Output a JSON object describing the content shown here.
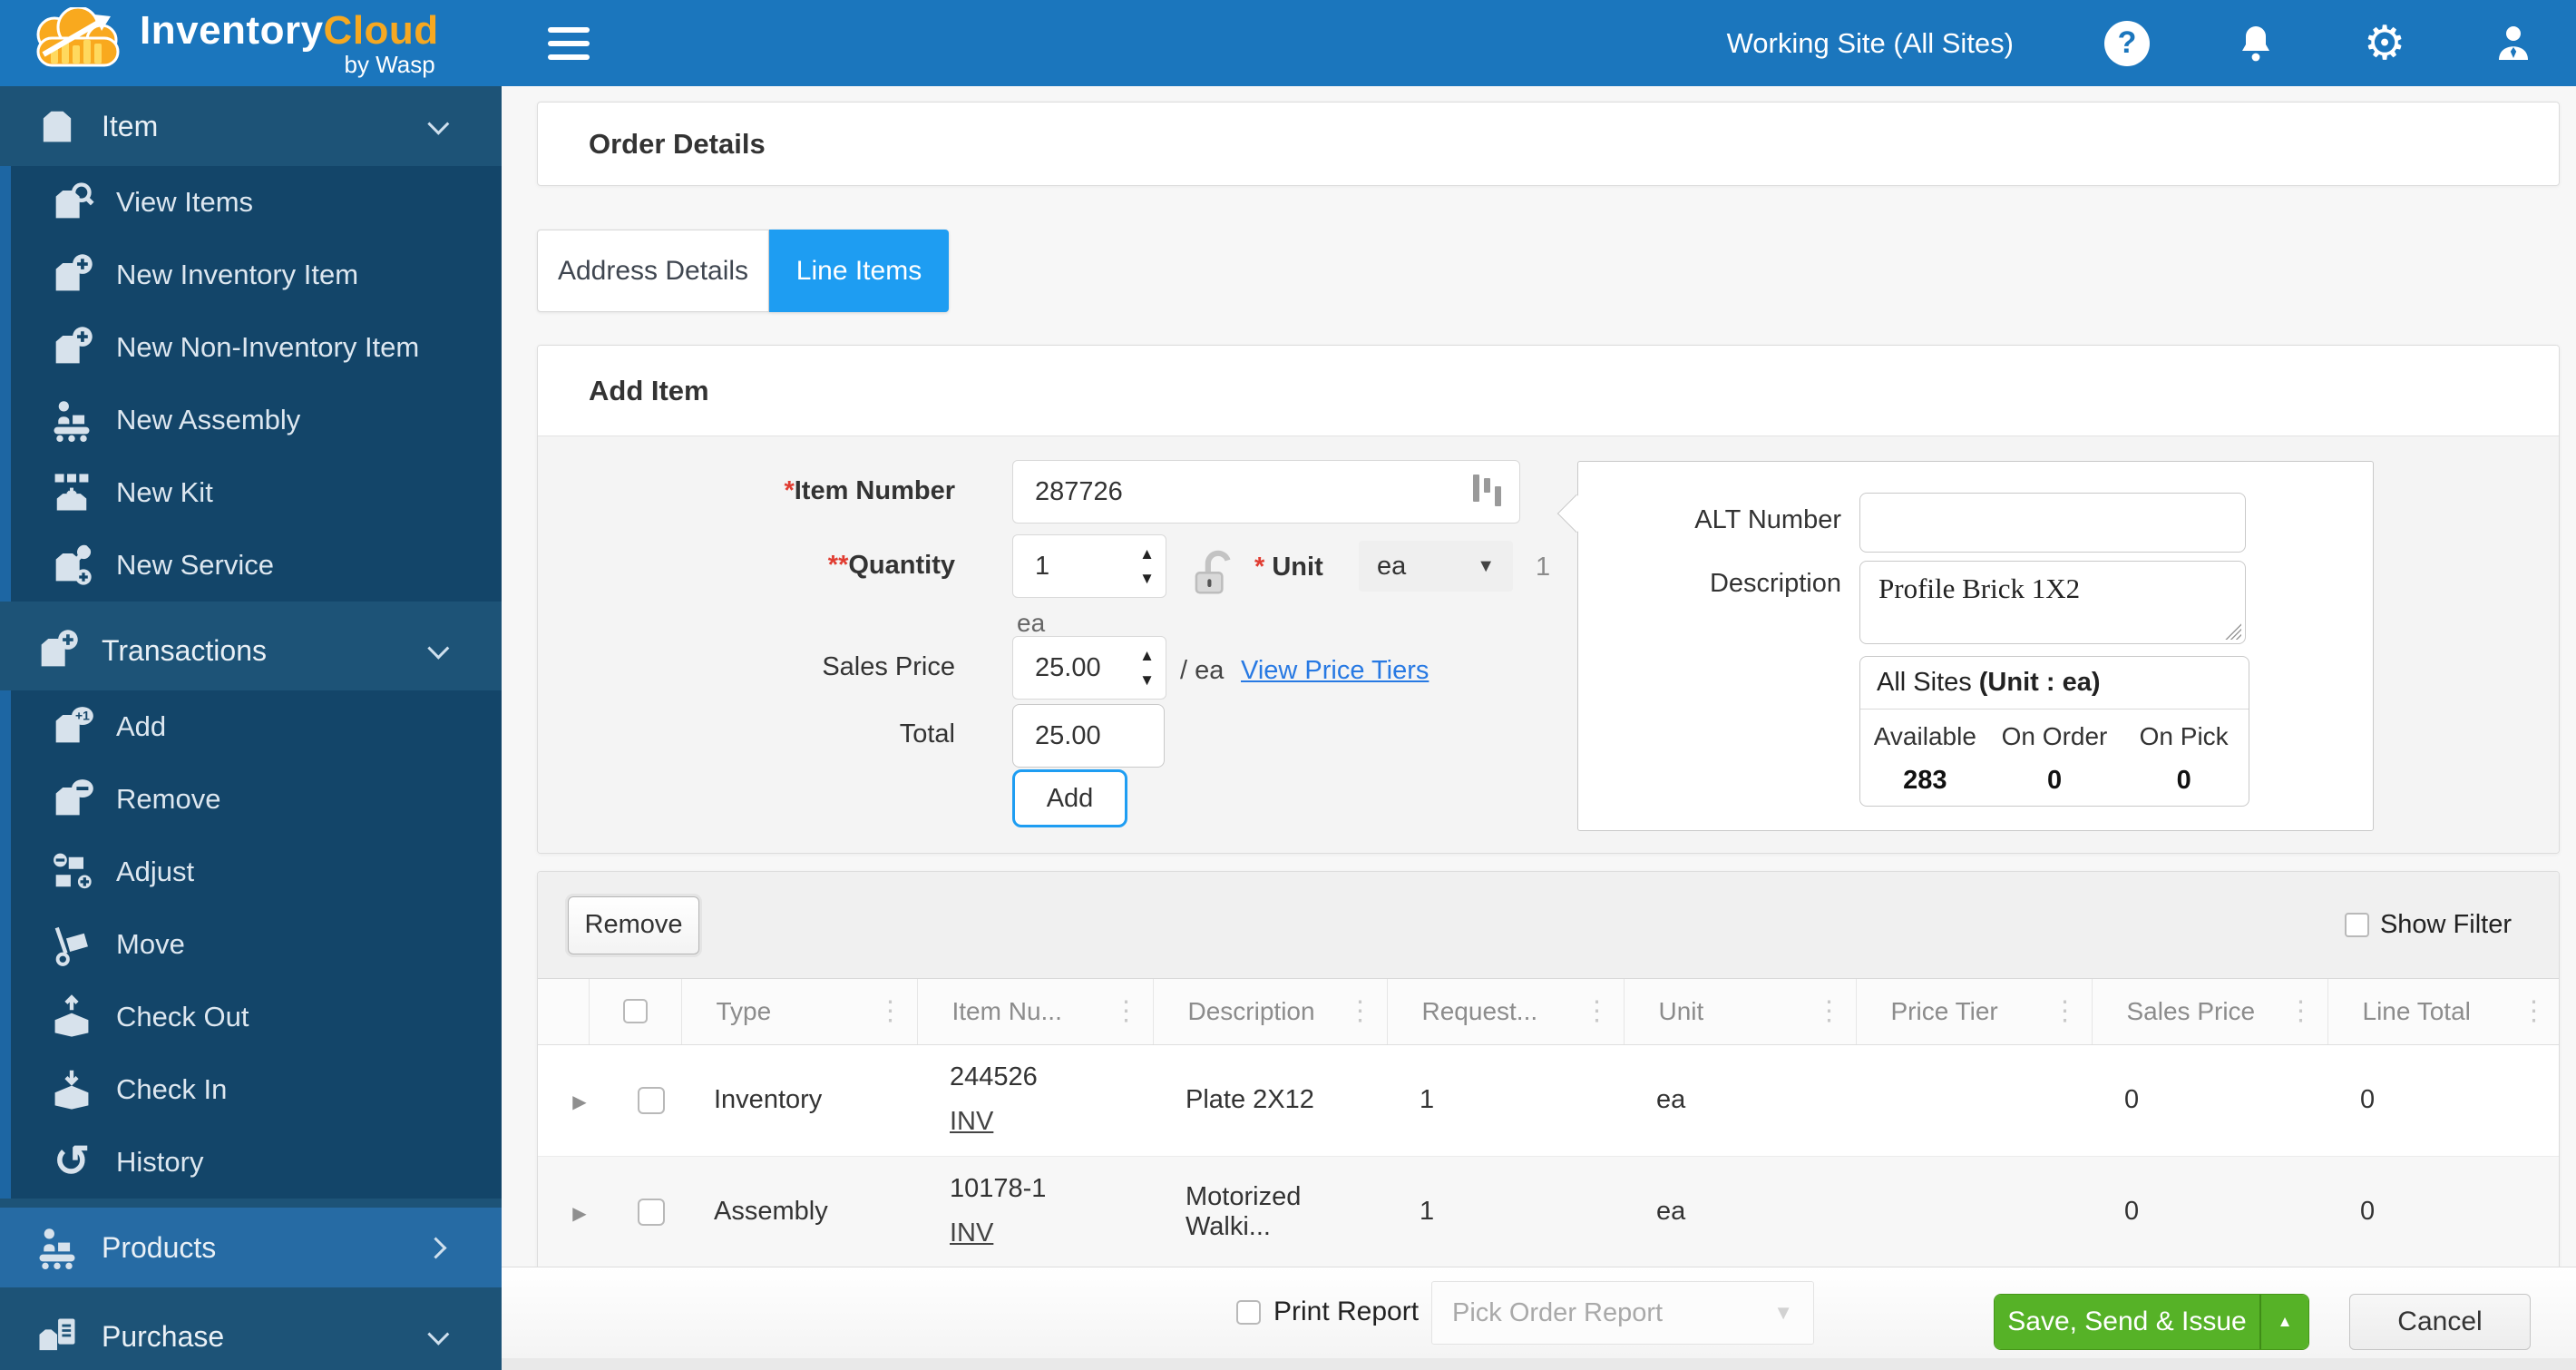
{
  "header": {
    "brand": {
      "part1": "Inventory",
      "part2": "Cloud",
      "byline": "by Wasp"
    },
    "working_site": "Working Site (All Sites)",
    "help_glyph": "?",
    "icons": [
      "menu-icon",
      "help-icon",
      "bell-icon",
      "gear-icon",
      "user-icon"
    ]
  },
  "sidebar": {
    "sections": [
      {
        "label": "Item",
        "state": "expanded",
        "items": [
          "View Items",
          "New Inventory Item",
          "New Non-Inventory Item",
          "New Assembly",
          "New Kit",
          "New Service"
        ]
      },
      {
        "label": "Transactions",
        "state": "expanded",
        "items": [
          "Add",
          "Remove",
          "Adjust",
          "Move",
          "Check Out",
          "Check In",
          "History"
        ]
      },
      {
        "label": "Products",
        "state": "collapsed",
        "items": []
      },
      {
        "label": "Purchase",
        "state": "expanded",
        "items": []
      }
    ]
  },
  "main": {
    "page_title": "Order Details",
    "tabs": [
      {
        "label": "Address Details",
        "active": false
      },
      {
        "label": "Line Items",
        "active": true
      }
    ],
    "add_item": {
      "title": "Add Item",
      "item_number": {
        "required": "*",
        "label": "Item Number",
        "value": "287726"
      },
      "quantity": {
        "required": "**",
        "label": "Quantity",
        "value": "1",
        "uom_below": "ea"
      },
      "unit": {
        "required": "*",
        "label": "Unit",
        "value": "ea",
        "conversion": "1"
      },
      "sales_price": {
        "label": "Sales Price",
        "value": "25.00",
        "per_unit": "/ ea",
        "tiers_link": "View Price Tiers"
      },
      "total": {
        "label": "Total",
        "value": "25.00"
      },
      "add_button": "Add",
      "item_info": {
        "alt_number_label": "ALT Number",
        "alt_number_value": "",
        "description_label": "Description",
        "description_value": "Profile Brick 1X2",
        "sites_scope": "All Sites",
        "sites_unit": "(Unit : ea)",
        "stock_headers": [
          "Available",
          "On Order",
          "On Pick"
        ],
        "stock_values": [
          "283",
          "0",
          "0"
        ]
      }
    },
    "line_items": {
      "remove_button": "Remove",
      "show_filter_label": "Show Filter",
      "columns": [
        "Type",
        "Item Nu...",
        "Description",
        "Request...",
        "Unit",
        "Price Tier",
        "Sales Price",
        "Line Total"
      ],
      "rows": [
        {
          "type": "Inventory",
          "item_number": "244526",
          "item_link": "INV",
          "description": "Plate 2X12",
          "requested": "1",
          "unit": "ea",
          "price_tier": "",
          "sales_price": "0",
          "line_total": "0"
        },
        {
          "type": "Assembly",
          "item_number": "10178-1",
          "item_link": "INV",
          "description": "Motorized Walki...",
          "requested": "1",
          "unit": "ea",
          "price_tier": "",
          "sales_price": "0",
          "line_total": "0"
        }
      ]
    },
    "footer": {
      "print_report_label": "Print Report",
      "report_select_value": "Pick Order Report",
      "save_button": "Save, Send & Issue",
      "cancel_button": "Cancel"
    }
  },
  "colors": {
    "header_blue": "#1b76bd",
    "sidebar_header": "#1d5377",
    "sidebar_submenu": "#134569",
    "sidebar_stripe": "#1d66a3",
    "sidebar_products_row": "#266ba4",
    "active_tab_blue": "#1e9df2",
    "link_blue": "#2779e3",
    "save_green": "#56b227",
    "required_red": "#e03c31"
  }
}
